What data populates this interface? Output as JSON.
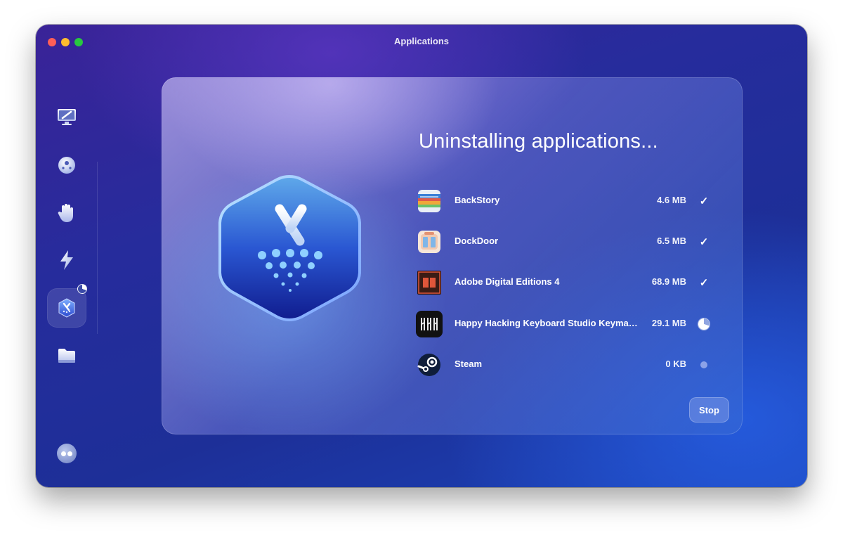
{
  "window": {
    "title": "Applications"
  },
  "sidebar": {
    "items": [
      {
        "icon": "monitor-broom-icon"
      },
      {
        "icon": "protection-disc-icon"
      },
      {
        "icon": "privacy-hand-icon"
      },
      {
        "icon": "speed-bolt-icon"
      },
      {
        "icon": "applications-uninstaller-icon",
        "active": true,
        "progress": 0.3
      },
      {
        "icon": "files-folder-icon"
      }
    ],
    "assistant_icon": "assistant-avatar-icon"
  },
  "main": {
    "heading": "Uninstalling applications...",
    "apps": [
      {
        "name": "BackStory",
        "size": "4.6 MB",
        "status": "done",
        "icon": "backstory-app-icon"
      },
      {
        "name": "DockDoor",
        "size": "6.5 MB",
        "status": "done",
        "icon": "dockdoor-app-icon"
      },
      {
        "name": "Adobe Digital Editions 4",
        "size": "68.9 MB",
        "status": "done",
        "icon": "adobe-digital-editions-app-icon"
      },
      {
        "name": "Happy Hacking Keyboard Studio Keymap T...",
        "size": "29.1 MB",
        "status": "in-progress",
        "progress": 0.7,
        "icon": "hhkb-keymap-app-icon"
      },
      {
        "name": "Steam",
        "size": "0 KB",
        "status": "pending",
        "icon": "steam-app-icon"
      }
    ],
    "stop_label": "Stop"
  },
  "colors": {
    "close": "#ff5f57",
    "minimize": "#febc2e",
    "maximize": "#28c840",
    "accent": "#2a3aa8"
  }
}
